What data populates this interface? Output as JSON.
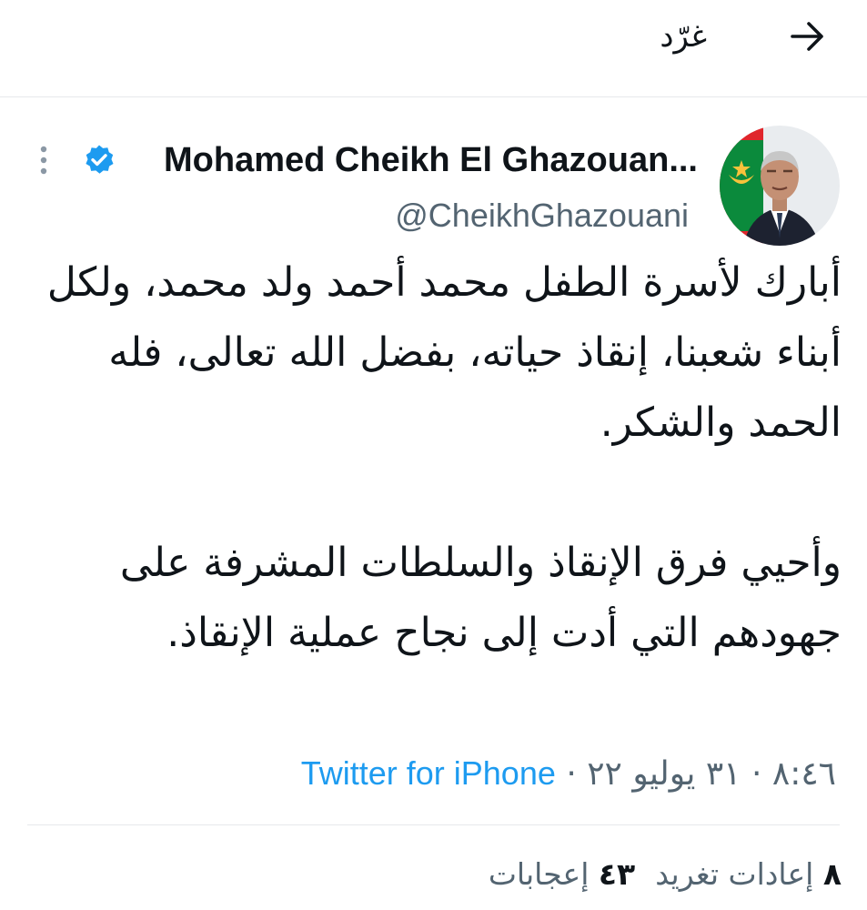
{
  "header": {
    "title": "غرّد",
    "back_icon": "arrow-right-icon"
  },
  "author": {
    "display_name": "Mohamed Cheikh El Ghazouan...",
    "handle": "@CheikhGhazouani",
    "verified": true,
    "verified_color": "#1d9bf0"
  },
  "tweet": {
    "paragraph_1": "أبارك لأسرة الطفل محمد أحمد ولد محمد، ولكل أبناء شعبنا، إنقاذ حياته، بفضل الله تعالى، فله الحمد والشكر.",
    "paragraph_2": "وأحيي فرق الإنقاذ والسلطات المشرفة على جهودهم التي أدت إلى نجاح عملية الإنقاذ."
  },
  "meta": {
    "time": "٨:٤٦",
    "separator": "·",
    "date": "٣١ يوليو ٢٢",
    "source": "Twitter for iPhone"
  },
  "stats": {
    "retweets_count": "٨",
    "retweets_label": "إعادات تغريد",
    "likes_count": "٤٣",
    "likes_label": "إعجابات"
  },
  "colors": {
    "link": "#1d9bf0",
    "secondary_text": "#536471",
    "primary_text": "#0f1419"
  }
}
